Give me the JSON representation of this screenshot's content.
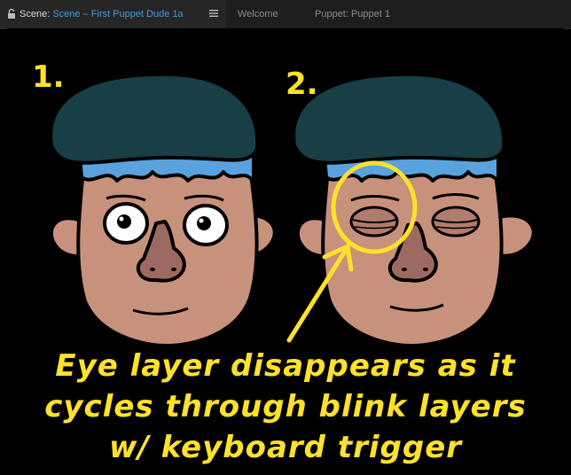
{
  "tabs": {
    "scene_prefix": "Scene:",
    "scene_name": "Scene – First Puppet Dude 1a",
    "welcome": "Welcome",
    "puppet": "Puppet: Puppet 1"
  },
  "icons": {
    "lock": "lock-icon",
    "menu": "hamburger-menu-icon"
  },
  "annotations": {
    "label_1": "1.",
    "label_2": "2.",
    "caption_line_1": "Eye layer disappears as it",
    "caption_line_2": "cycles through blink layers",
    "caption_line_3": "w/ keyboard trigger"
  },
  "colors": {
    "accent_blue": "#3d9cdc",
    "annotation_yellow": "#ffe12b",
    "hat": "#173f45",
    "hair": "#5aa2de",
    "skin": "#c8917c",
    "nose": "#9c6a62"
  }
}
